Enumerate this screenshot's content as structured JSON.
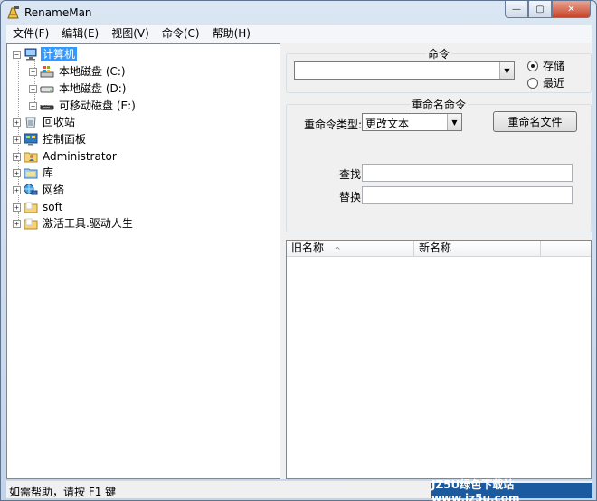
{
  "window": {
    "title": "RenameMan",
    "controls": {
      "minimize": "—",
      "maximize": "▢",
      "close": "✕"
    }
  },
  "menubar": {
    "items": [
      {
        "label": "文件(F)"
      },
      {
        "label": "编辑(E)"
      },
      {
        "label": "视图(V)"
      },
      {
        "label": "命令(C)"
      },
      {
        "label": "帮助(H)"
      }
    ]
  },
  "tree": {
    "root": {
      "label": "计算机",
      "icon": "computer-icon",
      "selected": true
    },
    "drives": [
      {
        "label": "本地磁盘 (C:)",
        "icon": "system-drive-icon"
      },
      {
        "label": "本地磁盘 (D:)",
        "icon": "drive-icon"
      },
      {
        "label": "可移动磁盘 (E:)",
        "icon": "removable-drive-icon"
      }
    ],
    "items": [
      {
        "label": "回收站",
        "icon": "recycle-bin-icon"
      },
      {
        "label": "控制面板",
        "icon": "control-panel-icon"
      },
      {
        "label": "Administrator",
        "icon": "user-folder-icon"
      },
      {
        "label": "库",
        "icon": "library-icon"
      },
      {
        "label": "网络",
        "icon": "network-icon"
      },
      {
        "label": "soft",
        "icon": "folder-icon"
      },
      {
        "label": "激活工具.驱动人生",
        "icon": "folder-icon"
      }
    ]
  },
  "command_group": {
    "legend": "命令",
    "combo_value": "",
    "radio_save": "存储",
    "radio_recent": "最近",
    "selected": "save"
  },
  "rename_group": {
    "legend": "重命名命令",
    "type_label": "重命令类型:",
    "type_value": "更改文本",
    "rename_button": "重命名文件",
    "find_label": "查找:",
    "find_value": "",
    "replace_label": "替换:",
    "replace_value": ""
  },
  "listview": {
    "columns": [
      {
        "label": "旧名称"
      },
      {
        "label": "新名称"
      }
    ]
  },
  "statusbar": {
    "text": "如需帮助，请按 F1 键"
  },
  "watermark": {
    "text": "JZ5U绿色下载站 www.jz5u.com"
  },
  "colors": {
    "selection": "#3399ff",
    "window_frame": "#c4d4e8"
  }
}
